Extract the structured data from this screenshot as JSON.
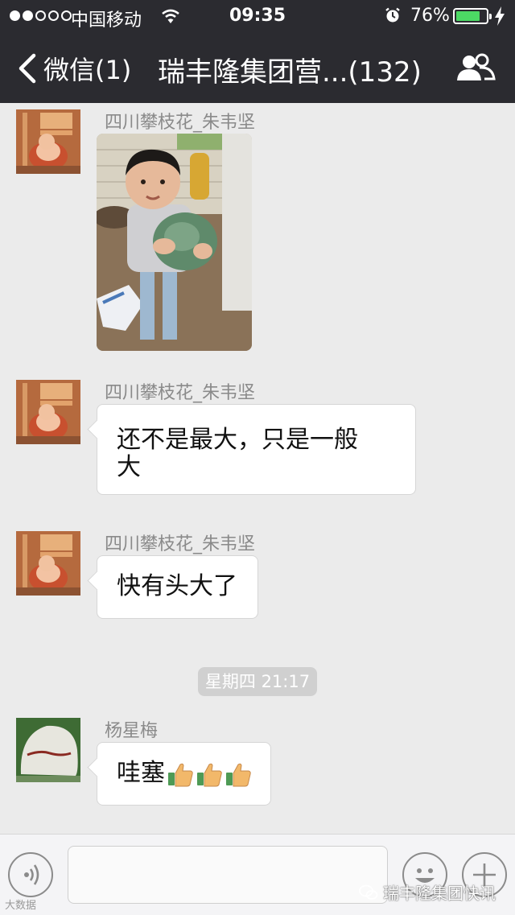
{
  "status_bar": {
    "carrier": "中国移动",
    "time": "09:35",
    "battery": "76%",
    "battery_level": 0.76
  },
  "nav": {
    "back_label": "微信(1)",
    "title": "瑞丰隆集团营...(132)"
  },
  "messages": [
    {
      "sender": "四川攀枝花_朱韦坚",
      "type": "image"
    },
    {
      "sender": "四川攀枝花_朱韦坚",
      "type": "text",
      "text_line1": "还不是最大，只是一般",
      "text_line2": "大"
    },
    {
      "sender": "四川攀枝花_朱韦坚",
      "type": "text",
      "text": "快有头大了"
    },
    {
      "sender": "杨星梅",
      "type": "text",
      "text": "哇塞",
      "emoji_count": 3
    }
  ],
  "timestamp": "星期四 21:17",
  "watermarks": {
    "bottom_left": "大数据",
    "bottom_right": "瑞丰隆集团快讯"
  },
  "icons": [
    "wifi-icon",
    "alarm-icon",
    "battery-icon",
    "back-chevron-icon",
    "group-people-icon",
    "voice-icon",
    "emoji-icon",
    "plus-icon",
    "thumbs-up-icon",
    "wechat-logo-icon"
  ],
  "colors": {
    "nav_bg": "#2b2b30",
    "chat_bg": "#ebebeb",
    "battery_green": "#4cd964",
    "thumb": "#f2b86a"
  }
}
